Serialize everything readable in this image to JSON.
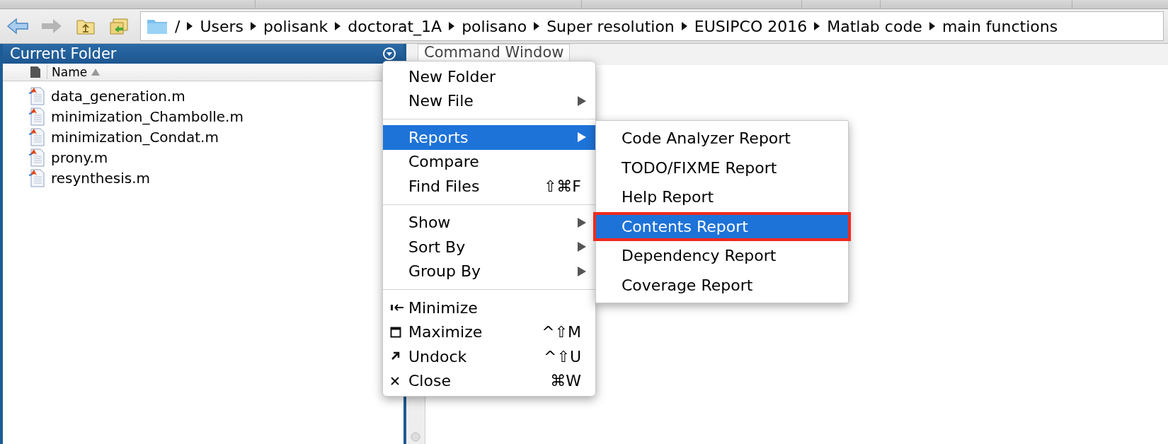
{
  "address_bar": {
    "crumbs": [
      "/",
      "Users",
      "polisank",
      "doctorat_1A",
      "polisano",
      "Super resolution",
      "EUSIPCO 2016",
      "Matlab code",
      "main functions"
    ]
  },
  "current_folder": {
    "title": "Current Folder",
    "column": "Name",
    "files": [
      "data_generation.m",
      "minimization_Chambolle.m",
      "minimization_Condat.m",
      "prony.m",
      "resynthesis.m"
    ]
  },
  "command_window": {
    "title": "Command Window"
  },
  "context_menu": {
    "items": [
      {
        "kind": "item",
        "label": "New Folder",
        "submenu": false,
        "selected": false
      },
      {
        "kind": "item",
        "label": "New File",
        "submenu": true,
        "selected": false
      },
      {
        "kind": "separator"
      },
      {
        "kind": "item",
        "label": "Reports",
        "submenu": true,
        "selected": true
      },
      {
        "kind": "item",
        "label": "Compare",
        "submenu": false,
        "selected": false
      },
      {
        "kind": "item",
        "label": "Find Files",
        "shortcut": "⇧⌘F",
        "submenu": false,
        "selected": false
      },
      {
        "kind": "separator"
      },
      {
        "kind": "item",
        "label": "Show",
        "submenu": true,
        "selected": false
      },
      {
        "kind": "item",
        "label": "Sort By",
        "submenu": true,
        "selected": false
      },
      {
        "kind": "item",
        "label": "Group By",
        "submenu": true,
        "selected": false
      },
      {
        "kind": "separator"
      },
      {
        "kind": "minimize",
        "label": "Minimize",
        "submenu": false,
        "selected": false
      },
      {
        "kind": "maximize",
        "label": "Maximize",
        "shortcut": "^⇧M",
        "submenu": false,
        "selected": false
      },
      {
        "kind": "undock",
        "label": "Undock",
        "shortcut": "^⇧U",
        "submenu": false,
        "selected": false
      },
      {
        "kind": "close",
        "label": "Close",
        "shortcut": "⌘W",
        "submenu": false,
        "selected": false
      }
    ]
  },
  "reports_submenu": {
    "items": [
      {
        "label": "Code Analyzer Report",
        "selected": false,
        "outlined": false
      },
      {
        "label": "TODO/FIXME Report",
        "selected": false,
        "outlined": false
      },
      {
        "label": "Help Report",
        "selected": false,
        "outlined": false
      },
      {
        "label": "Contents Report",
        "selected": true,
        "outlined": true
      },
      {
        "label": "Dependency Report",
        "selected": false,
        "outlined": false
      },
      {
        "label": "Coverage Report",
        "selected": false,
        "outlined": false
      }
    ]
  }
}
